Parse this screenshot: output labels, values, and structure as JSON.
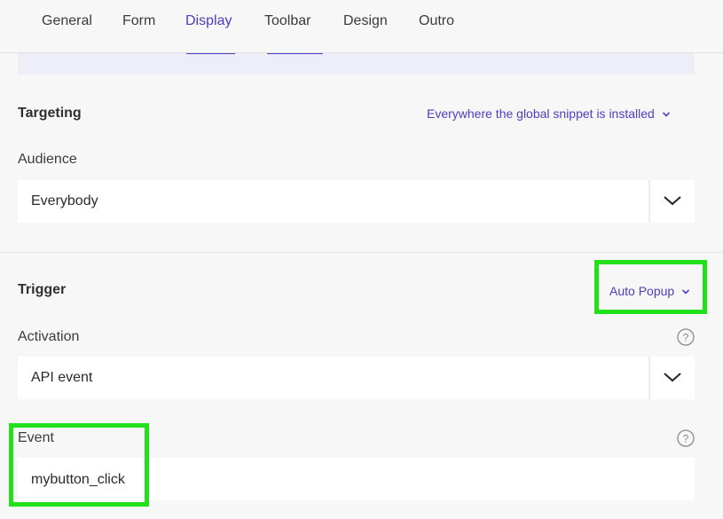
{
  "tabs": [
    "General",
    "Form",
    "Display",
    "Toolbar",
    "Design",
    "Outro"
  ],
  "targeting": {
    "title": "Targeting",
    "link": "Everywhere the global snippet is installed",
    "audience_label": "Audience",
    "audience_value": "Everybody"
  },
  "trigger": {
    "title": "Trigger",
    "link": "Auto Popup",
    "activation_label": "Activation",
    "activation_value": "API event",
    "event_label": "Event",
    "event_value": "mybutton_click"
  },
  "help_glyph": "?",
  "colors": {
    "accent": "#4b3fc1",
    "highlight": "#22e01a"
  }
}
